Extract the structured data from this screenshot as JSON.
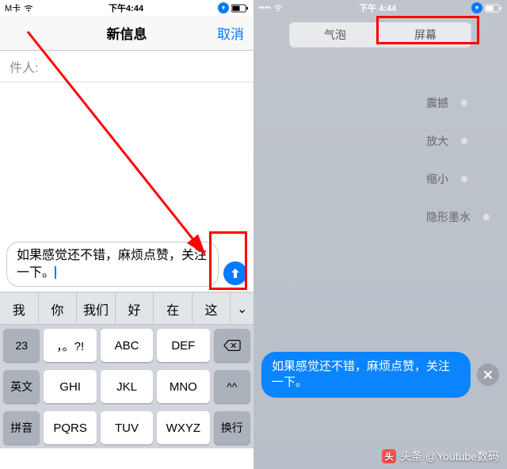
{
  "status": {
    "carrier": "M卡",
    "time": "下午4:44",
    "time_r": "下午 4:44"
  },
  "left": {
    "nav_title": "新信息",
    "cancel": "取消",
    "recipient_label": "件人:",
    "message_text": "如果感觉还不错，麻烦点赞，关注一下。",
    "suggestions": [
      "我",
      "你",
      "我们",
      "好",
      "在",
      "这"
    ],
    "kb": {
      "r1": [
        "23",
        "，。?!",
        "ABC",
        "DEF"
      ],
      "r2": [
        "英文",
        "GHI",
        "JKL",
        "MNO"
      ],
      "r3": [
        "拼音",
        "PQRS",
        "TUV",
        "WXYZ"
      ],
      "r4_last": "换行",
      "caret": "^^"
    }
  },
  "right": {
    "tabs": {
      "bubble": "气泡",
      "screen": "屏幕"
    },
    "effects": [
      "震撼",
      "放大",
      "缩小",
      "隐形墨水"
    ],
    "bubble_text": "如果感觉还不错，麻烦点赞，关注一下。"
  },
  "watermark": "头条 @Youtube数码"
}
